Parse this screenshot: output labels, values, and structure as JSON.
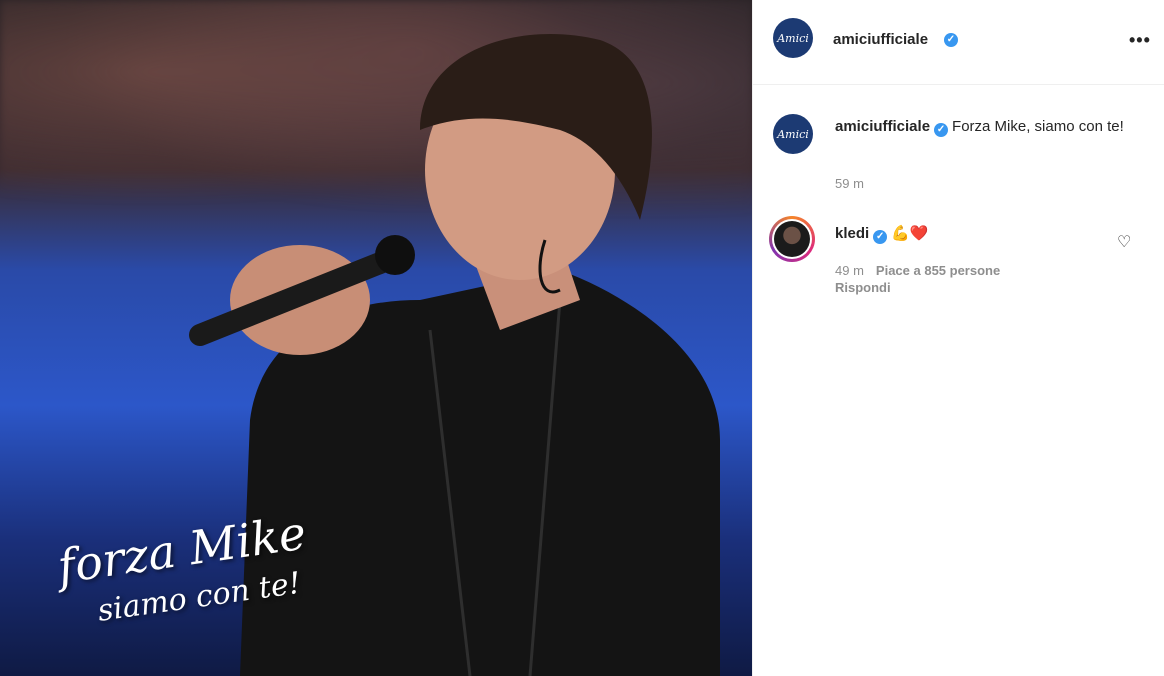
{
  "post": {
    "author": "amiciufficiale",
    "avatar_text": "Amici",
    "photo_overlay": {
      "line1": "forza Mike",
      "line2": "siamo con te!"
    },
    "more_label": "•••",
    "caption": {
      "username": "amiciufficiale",
      "text": "Forza Mike, siamo con te!",
      "time": "59 m"
    },
    "comments": [
      {
        "username": "kledi",
        "emojis": "💪❤️",
        "time": "49 m",
        "likes_text": "Piace a 855 persone",
        "reply_label": "Rispondi",
        "heart_icon": "♡"
      }
    ]
  },
  "colors": {
    "verified": "#3897f0",
    "muted": "#8e8e8e",
    "text": "#262626"
  }
}
